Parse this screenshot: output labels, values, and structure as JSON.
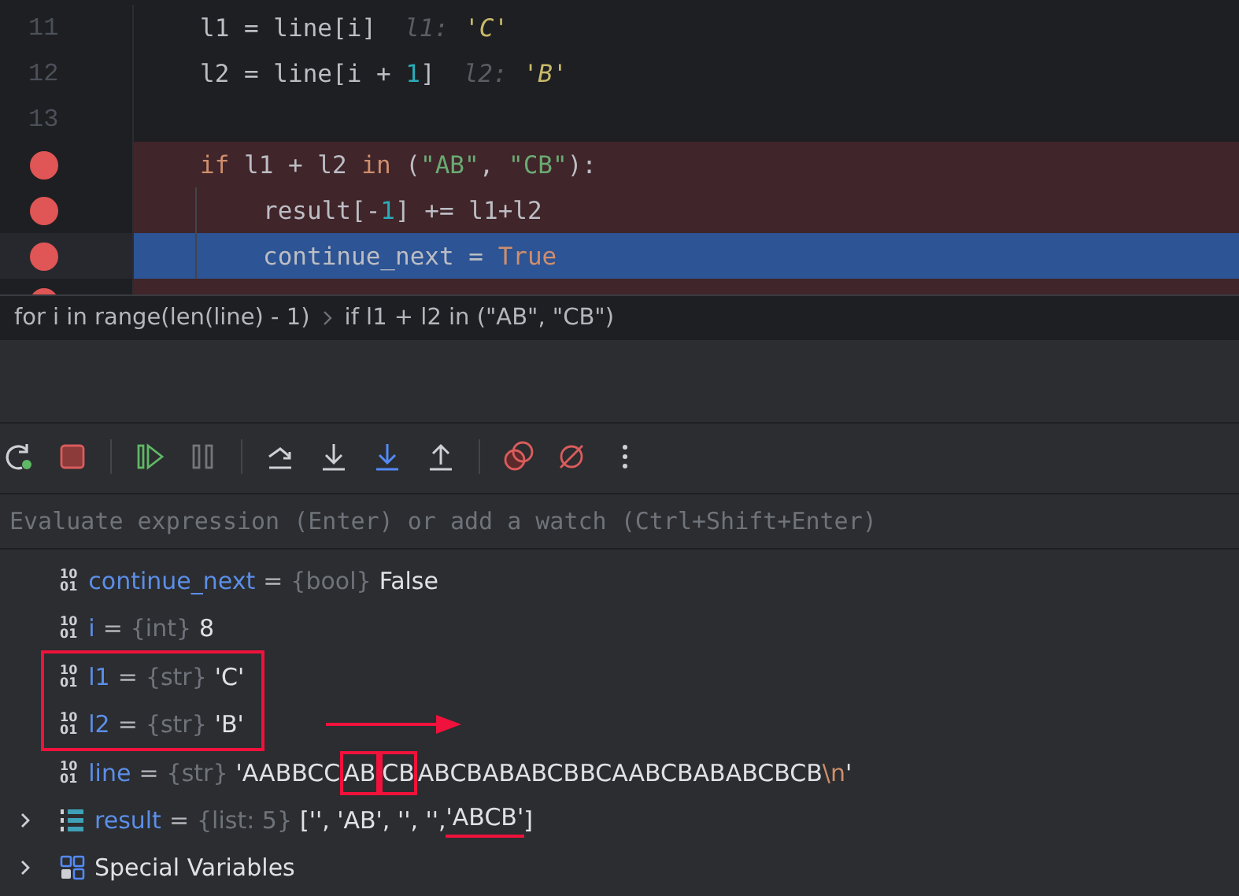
{
  "editor": {
    "lines": [
      {
        "number": "11",
        "breakpoint": false,
        "current": false,
        "tokens": [
          {
            "kind": "plain",
            "text": "l1 = line[i]"
          },
          {
            "kind": "inlay_name",
            "text": "l1:"
          },
          {
            "kind": "inlay_value",
            "text": "'C'"
          }
        ]
      },
      {
        "number": "12",
        "breakpoint": false,
        "current": false,
        "tokens": [
          {
            "kind": "plain",
            "text": "l2 = line[i + "
          },
          {
            "kind": "number",
            "text": "1"
          },
          {
            "kind": "plain",
            "text": "]"
          },
          {
            "kind": "inlay_name",
            "text": "l2:"
          },
          {
            "kind": "inlay_value",
            "text": "'B'"
          }
        ]
      },
      {
        "number": "13",
        "breakpoint": false,
        "current": false
      },
      {
        "breakpoint": true,
        "current": false,
        "tokens": [
          {
            "kind": "keyword",
            "text": "if "
          },
          {
            "kind": "plain",
            "text": "l1 + l2 "
          },
          {
            "kind": "keyword",
            "text": "in "
          },
          {
            "kind": "plain",
            "text": "("
          },
          {
            "kind": "string",
            "text": "\"AB\""
          },
          {
            "kind": "plain",
            "text": ", "
          },
          {
            "kind": "string",
            "text": "\"CB\""
          },
          {
            "kind": "plain",
            "text": "):"
          }
        ],
        "children": [
          {
            "breakpoint": true,
            "current": false,
            "tokens": [
              {
                "kind": "plain",
                "text": "result[-"
              },
              {
                "kind": "number",
                "text": "1"
              },
              {
                "kind": "plain",
                "text": "] += l1+l2"
              }
            ]
          },
          {
            "breakpoint": true,
            "current": true,
            "tokens": [
              {
                "kind": "plain",
                "text": "continue_next = "
              },
              {
                "kind": "keyword",
                "text": "True"
              }
            ]
          }
        ]
      },
      {
        "breakpoint": true,
        "current": false
      }
    ]
  },
  "breadcrumbs": [
    {
      "label": "for i in range(len(line) - 1)"
    },
    {
      "label": "if l1 + l2 in (\"AB\", \"CB\")"
    }
  ],
  "toolbar": [
    {
      "kind": "rerun",
      "disabled": false
    },
    {
      "kind": "stop",
      "disabled": false
    },
    {
      "kind": "separator"
    },
    {
      "kind": "resume",
      "disabled": false
    },
    {
      "kind": "pause",
      "disabled": true
    },
    {
      "kind": "separator"
    },
    {
      "kind": "step_over",
      "disabled": false
    },
    {
      "kind": "step_into",
      "disabled": false
    },
    {
      "kind": "step_into_my_code",
      "disabled": false
    },
    {
      "kind": "step_out",
      "disabled": false
    },
    {
      "kind": "separator"
    },
    {
      "kind": "breakpoints",
      "disabled": false
    },
    {
      "kind": "mute",
      "disabled": false
    },
    {
      "kind": "more",
      "disabled": false
    }
  ],
  "evaluate": {
    "placeholder": "Evaluate expression (Enter) or add a watch (Ctrl+Shift+Enter)"
  },
  "variables": [
    {
      "kind": "primitive",
      "icon_text": [
        "10",
        "01"
      ],
      "expandable": false,
      "boxed": false,
      "name": "continue_next",
      "separator": "=",
      "type": "{bool}",
      "value": [
        {
          "text": "False",
          "kind": "plain",
          "marked": false
        }
      ]
    },
    {
      "kind": "primitive",
      "icon_text": [
        "10",
        "01"
      ],
      "expandable": false,
      "boxed": false,
      "name": "i",
      "separator": "=",
      "type": "{int}",
      "value": [
        {
          "text": "8",
          "kind": "plain",
          "marked": false
        }
      ]
    },
    {
      "kind": "primitive",
      "icon_text": [
        "10",
        "01"
      ],
      "expandable": false,
      "boxed": true,
      "name": "l1",
      "separator": "=",
      "type": "{str}",
      "value": [
        {
          "text": "'C'",
          "kind": "plain",
          "marked": false
        }
      ]
    },
    {
      "kind": "primitive",
      "icon_text": [
        "10",
        "01"
      ],
      "expandable": false,
      "boxed": true,
      "name": "l2",
      "separator": "=",
      "type": "{str}",
      "value": [
        {
          "text": "'B'",
          "kind": "plain",
          "marked": false
        }
      ]
    },
    {
      "kind": "primitive",
      "icon_text": [
        "10",
        "01"
      ],
      "expandable": false,
      "boxed": false,
      "name": "line",
      "separator": "=",
      "type": "{str}",
      "value": [
        {
          "text": "'AABBCC",
          "kind": "plain",
          "marked": false
        },
        {
          "text": "AB",
          "kind": "plain",
          "marked": true
        },
        {
          "text": "CB",
          "kind": "plain",
          "marked": true
        },
        {
          "text": "ABCBABABCBBCAABCBABABCBCB",
          "kind": "plain",
          "marked": false
        },
        {
          "text": "\\n",
          "kind": "escape",
          "marked": false
        },
        {
          "text": "'",
          "kind": "plain",
          "marked": false
        }
      ]
    },
    {
      "kind": "list",
      "expandable": true,
      "boxed": false,
      "name": "result",
      "separator": "=",
      "type": "{list: 5}",
      "value": [
        {
          "text": "['', 'AB', '', '', ",
          "kind": "plain",
          "marked": false
        },
        {
          "text": "'ABCB'",
          "kind": "underline",
          "marked": true
        },
        {
          "text": "]",
          "kind": "plain",
          "marked": false
        }
      ]
    },
    {
      "kind": "group",
      "expandable": true,
      "boxed": false,
      "name": "Special Variables"
    }
  ]
}
